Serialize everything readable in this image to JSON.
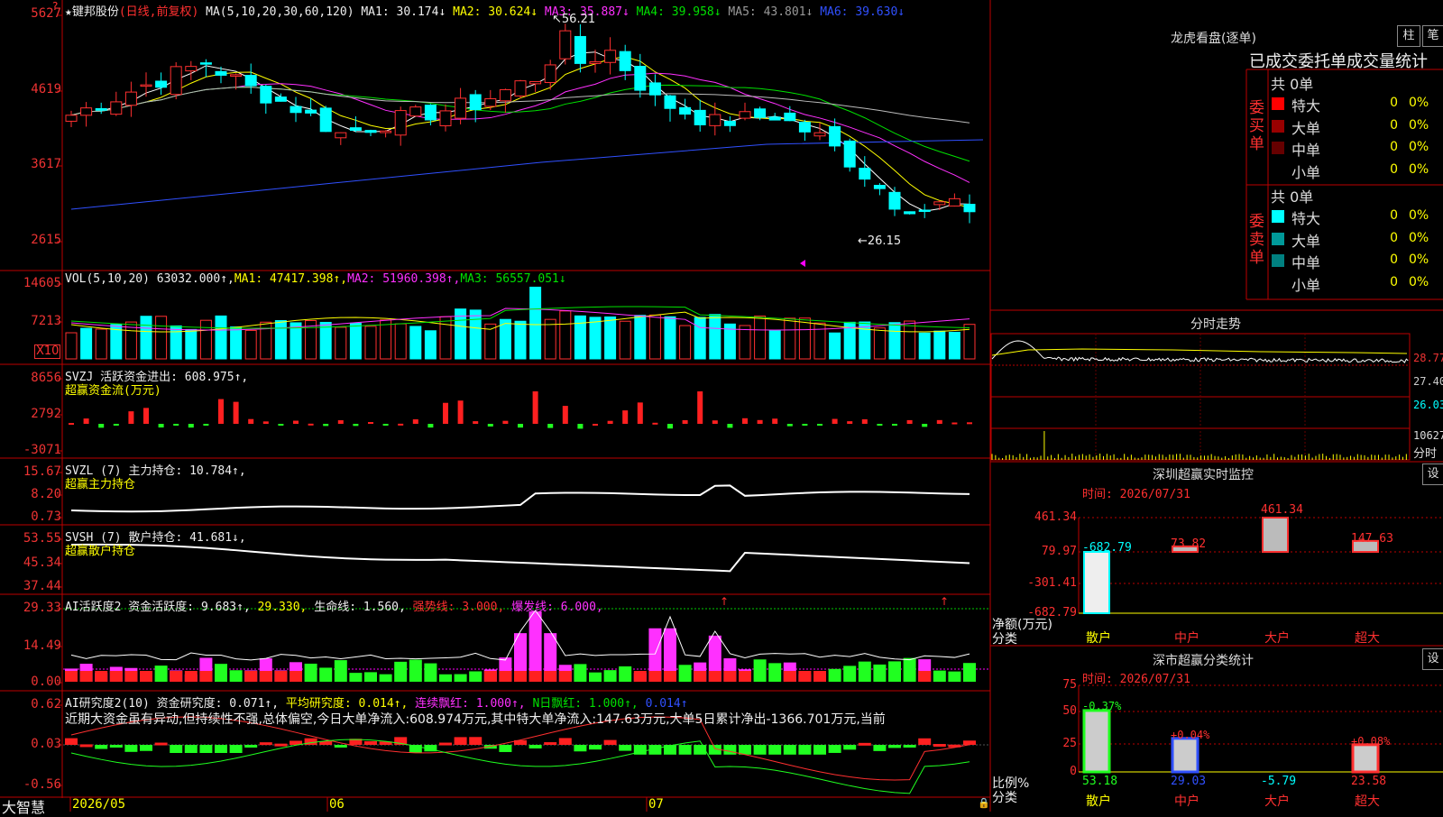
{
  "stock": {
    "name": "键邦股份",
    "mode": "(日线,前复权)",
    "ma_params": "MA(5,10,20,30,60,120)",
    "ma": [
      {
        "label": "MA1:",
        "value": "30.174↓",
        "color": "#ffffff"
      },
      {
        "label": "MA2:",
        "value": "30.624↓",
        "color": "#ffff00"
      },
      {
        "label": "MA3:",
        "value": "35.887↓",
        "color": "#ff30ff"
      },
      {
        "label": "MA4:",
        "value": "39.958↓",
        "color": "#00e000"
      },
      {
        "label": "MA5:",
        "value": "43.801↓",
        "color": "#cccccc"
      },
      {
        "label": "MA6:",
        "value": "39.630↓",
        "color": "#3050ff"
      }
    ],
    "high_mark": "56.21",
    "low_mark": "←26.15",
    "price_axis": [
      "5627",
      "4619",
      "3617",
      "2615"
    ],
    "question_mark": "?"
  },
  "vol": {
    "header_params": "VOL(5,10,20)",
    "value": "63032.000↑,",
    "ma1": "MA1: 47417.398↑,",
    "ma2": "MA2: 51960.398↑,",
    "ma3": "MA3: 56557.051↓",
    "axis": [
      "14605",
      "7213"
    ],
    "unit": "X10"
  },
  "svzj": {
    "header": "SVZJ  活跃资金进出: 608.975↑,",
    "sub": "超赢资金流(万元)",
    "axis": [
      "8656",
      "2792",
      "-3071"
    ]
  },
  "svzl": {
    "header": "SVZL (7) 主力持仓: 10.784↑,",
    "sub": "超赢主力持仓",
    "axis": [
      "15.67",
      "8.20",
      "0.73"
    ]
  },
  "svsh": {
    "header": "SVSH (7) 散户持仓: 41.681↓,",
    "sub": "超赢散户持仓",
    "axis": [
      "53.55",
      "45.34",
      "37.44"
    ]
  },
  "ai_active": {
    "h1": "AI活跃度2 资金活跃度: 9.683↑,",
    "h2": "29.330,",
    "h3": "生命线: 1.560,",
    "h4": "强势线: 3.000,",
    "h5": "爆发线: 6.000,",
    "axis": [
      "29.33",
      "14.49",
      "0.00"
    ]
  },
  "ai_research": {
    "h1": "AI研究度2(10) 资金研究度: 0.071↑,",
    "h2": "平均研究度: 0.014↑,",
    "h3": "连续飘红: 1.000↑,",
    "h4": "N日飘红: 1.000↑,",
    "h5": "0.014↑",
    "comment": "近期大资金虽有异动,但持续性不强,总体偏空,今日大单净流入:608.974万元,其中特大单净流入:147.63万元,大单5日累计净出-1366.701万元,当前",
    "axis": [
      "0.62",
      "0.03",
      "-0.56"
    ]
  },
  "bottom": {
    "brand": "大智慧",
    "dates": [
      "2026/05",
      "06",
      "07"
    ]
  },
  "right": {
    "lhb_title": "龙虎看盘(逐单)",
    "btn_zhu": "柱",
    "btn_bi": "笔",
    "order_title": "已成交委托单成交量统计",
    "buy_side": "委买单",
    "sell_side": "委卖单",
    "buy_total": "共 0单",
    "sell_total": "共 0单",
    "buy_rows": [
      {
        "label": "特大",
        "count": "0",
        "pct": "0%",
        "color": "#ff0000"
      },
      {
        "label": "大单",
        "count": "0",
        "pct": "0%",
        "color": "#990000"
      },
      {
        "label": "中单",
        "count": "0",
        "pct": "0%",
        "color": "#660000"
      },
      {
        "label": "小单",
        "count": "0",
        "pct": "0%",
        "color": ""
      }
    ],
    "sell_rows": [
      {
        "label": "特大",
        "count": "0",
        "pct": "0%",
        "color": "#00ffff"
      },
      {
        "label": "大单",
        "count": "0",
        "pct": "0%",
        "color": "#009999"
      },
      {
        "label": "中单",
        "count": "0",
        "pct": "0%",
        "color": "#008080"
      },
      {
        "label": "小单",
        "count": "0",
        "pct": "0%",
        "color": ""
      }
    ],
    "intraday_title": "分时走势",
    "intraday_axis": [
      "28.77",
      "27.40",
      "26.03",
      "10627"
    ],
    "intraday_unit": "分时",
    "sz_monitor_title": "深圳超赢实时监控",
    "sz_btn": "设",
    "sz_time": "时间: 2026/07/31",
    "sz_axis": [
      "461.34",
      "79.97",
      "-301.41",
      "-682.79"
    ],
    "sz_ylabel": "净额(万元)",
    "sz_xlabel": "分类",
    "sz_categories": [
      "散户",
      "中户",
      "大户",
      "超大"
    ],
    "sz_values": [
      -682.79,
      73.82,
      461.34,
      147.63
    ],
    "sz_value_labels": [
      "-682.79",
      "73.82",
      "461.34",
      "147.63"
    ],
    "cls_title": "深市超赢分类统计",
    "cls_btn": "设",
    "cls_time": "时间: 2026/07/31",
    "cls_axis": [
      "75",
      "50",
      "25",
      "0"
    ],
    "cls_ylabel": "比例%",
    "cls_xlabel": "分类",
    "cls_categories": [
      "散户",
      "中户",
      "大户",
      "超大"
    ],
    "cls_values": [
      53.18,
      29.03,
      -5.79,
      23.58
    ],
    "cls_top_labels": [
      "-0.37%",
      "+0.04%",
      "",
      "+0.08%"
    ],
    "cls_value_labels": [
      "53.18",
      "29.03",
      "-5.79",
      "23.58"
    ]
  }
}
